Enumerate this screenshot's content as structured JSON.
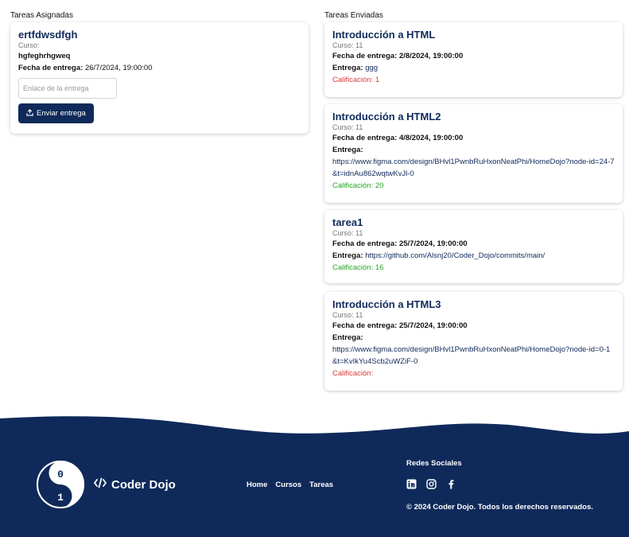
{
  "assigned": {
    "heading": "Tareas Asignadas",
    "tasks": [
      {
        "title": "ertfdwsdfgh",
        "course": "Curso:",
        "description": "hgfeghrhgweq",
        "due_label": "Fecha de entrega:",
        "due_value": "26/7/2024, 19:00:00",
        "input_placeholder": "Enlace de la entrega",
        "submit_label": "Enviar entrega"
      }
    ]
  },
  "sent": {
    "heading": "Tareas Enviadas",
    "tasks": [
      {
        "title": "Introducción a HTML",
        "course": "Curso: 11",
        "due_label": "Fecha de entrega:",
        "due_value": "2/8/2024, 19:00:00",
        "delivery_label": "Entrega:",
        "delivery_value": "ggg",
        "grade_text": "Calificación: 1",
        "grade_color": "#d33a3a"
      },
      {
        "title": "Introducción a HTML2",
        "course": "Curso: 11",
        "due_label": "Fecha de entrega:",
        "due_value": "4/8/2024, 19:00:00",
        "delivery_label": "Entrega:",
        "delivery_value": "https://www.figma.com/design/BHvl1PwnbRuHxonNeatPhi/HomeDojo?node-id=24-7&t=idnAu862wqtwKvJl-0",
        "grade_text": "Calificación: 20",
        "grade_color": "#2aa12a"
      },
      {
        "title": "tarea1",
        "course": "Curso: 11",
        "due_label": "Fecha de entrega:",
        "due_value": "25/7/2024, 19:00:00",
        "delivery_label": "Entrega:",
        "delivery_value": "https://github.com/Alsnj20/Coder_Dojo/commits/main/",
        "grade_text": "Calificación: 16",
        "grade_color": "#2aa12a"
      },
      {
        "title": "Introducción a HTML3",
        "course": "Curso: 11",
        "due_label": "Fecha de entrega:",
        "due_value": "25/7/2024, 19:00:00",
        "delivery_label": "Entrega:",
        "delivery_value": "https://www.figma.com/design/BHvl1PwnbRuHxonNeatPhi/HomeDojo?node-id=0-1&t=KvIkYu4Scb2uWZiF-0",
        "grade_text": "Calificación:",
        "grade_color": "#d33a3a"
      }
    ]
  },
  "footer": {
    "brand_name": "Coder Dojo",
    "nav": [
      "Home",
      "Cursos",
      "Tareas"
    ],
    "social_title": "Redes Sociales",
    "social_icons": [
      "linkedin-icon",
      "instagram-icon",
      "facebook-icon"
    ],
    "copyright": "© 2024 Coder Dojo. Todos los derechos reservados.",
    "bg_color": "#0f2a5a"
  },
  "colors": {
    "primary": "#0f2a5a",
    "grade_red": "#d33a3a",
    "grade_green": "#2aa12a"
  }
}
